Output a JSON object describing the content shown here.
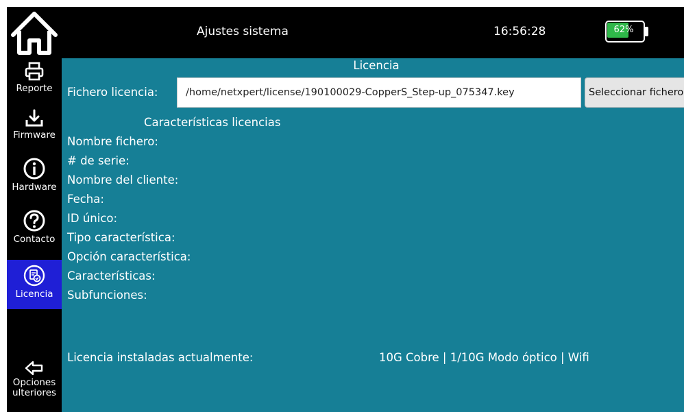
{
  "header": {
    "title": "Ajustes sistema",
    "time": "16:56:28",
    "battery": {
      "percent_label": "62%",
      "level": 0.62,
      "color": "#2fb84a"
    }
  },
  "sidebar": {
    "items": [
      {
        "label": "Reporte",
        "icon": "printer-icon"
      },
      {
        "label": "Firmware",
        "icon": "download-icon"
      },
      {
        "label": "Hardware",
        "icon": "info-icon"
      },
      {
        "label": "Contacto",
        "icon": "question-icon"
      },
      {
        "label": "Licencia",
        "icon": "license-icon",
        "active": true
      },
      {
        "label": "Opciones ulteriores",
        "line1": "Opciones",
        "line2": "ulteriores",
        "icon": "arrow-left-icon"
      }
    ]
  },
  "main": {
    "section_title": "Licencia",
    "file_label": "Fichero licencia:",
    "file_value": "/home/netxpert/license/190100029-CopperS_Step-up_075347.key",
    "select_button": "Seleccionar fichero",
    "features_heading": "Características licencias",
    "fields": [
      "Nombre fichero:",
      "# de serie:",
      "Nombre del cliente:",
      "Fecha:",
      "ID único:",
      "Tipo característica:",
      "Opción característica:",
      "Características:",
      "Subfunciones:"
    ],
    "installed_label": "Licencia instaladas actualmente:",
    "installed_value": "10G Cobre | 1/10G Modo óptico | Wifi"
  },
  "colors": {
    "panel": "#167f96",
    "bar": "#000000",
    "active": "#1f1fd6"
  }
}
